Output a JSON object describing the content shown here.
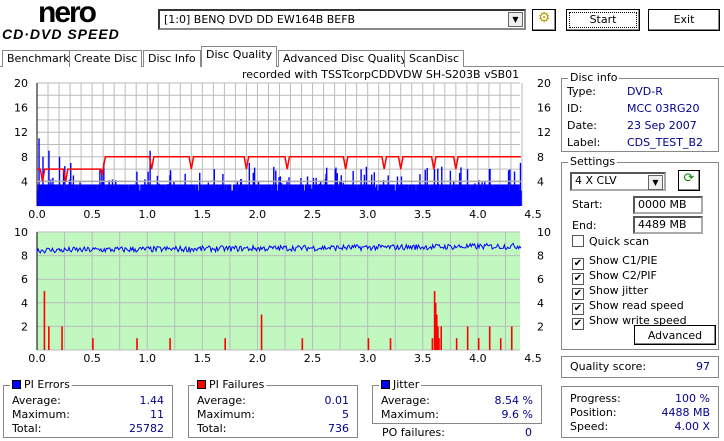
{
  "app": {
    "logo_top": "nero",
    "logo_bottom": "CD·DVD SPEED"
  },
  "toolbar": {
    "drive": "[1:0]  BENQ DVD DD EW164B BEFB",
    "start": "Start",
    "exit": "Exit"
  },
  "tabs": [
    "Benchmark",
    "Create Disc",
    "Disc Info",
    "Disc Quality",
    "Advanced Disc Quality",
    "ScanDisc"
  ],
  "active_tab": "Disc Quality",
  "recorded_with": "recorded with TSSTcorpCDDVDW SH-S203B  vSB01",
  "disc_info": {
    "title": "Disc info",
    "type_label": "Type:",
    "type": "DVD-R",
    "id_label": "ID:",
    "id": "MCC 03RG20",
    "date_label": "Date:",
    "date": "23 Sep 2007",
    "label_label": "Label:",
    "label": "CDS_TEST_B2"
  },
  "settings": {
    "title": "Settings",
    "speed": "4 X CLV",
    "start_label": "Start:",
    "start": "0000 MB",
    "end_label": "End:",
    "end": "4489 MB",
    "checks": [
      {
        "label": "Quick scan",
        "checked": false
      },
      {
        "label": "Show C1/PIE",
        "checked": true
      },
      {
        "label": "Show C2/PIF",
        "checked": true
      },
      {
        "label": "Show jitter",
        "checked": true
      },
      {
        "label": "Show read speed",
        "checked": true
      },
      {
        "label": "Show write speed",
        "checked": true
      }
    ],
    "advanced": "Advanced"
  },
  "quality": {
    "label": "Quality score:",
    "value": "97"
  },
  "progress": {
    "progress_label": "Progress:",
    "progress": "100 %",
    "position_label": "Position:",
    "position": "4488 MB",
    "speed_label": "Speed:",
    "speed": "4.00 X"
  },
  "pi_errors": {
    "title": "PI Errors",
    "avg_label": "Average:",
    "avg": "1.44",
    "max_label": "Maximum:",
    "max": "11",
    "total_label": "Total:",
    "total": "25782"
  },
  "pi_failures": {
    "title": "PI Failures",
    "avg_label": "Average:",
    "avg": "0.01",
    "max_label": "Maximum:",
    "max": "5",
    "total_label": "Total:",
    "total": "736"
  },
  "jitter": {
    "title": "Jitter",
    "avg_label": "Average:",
    "avg": "8.54 %",
    "max_label": "Maximum:",
    "max": "9.6 %"
  },
  "po_failures": {
    "label": "PO failures:",
    "value": "0"
  },
  "colors": {
    "pie": "#0000ff",
    "pif": "#ff0000",
    "speed": "#ff0000",
    "jitter_bg": "#c0f8c0"
  },
  "chart_data": [
    {
      "type": "bar",
      "name": "PI errors (top)",
      "xlim": [
        0,
        4.5
      ],
      "ylim": [
        0,
        20
      ],
      "x_ticks": [
        "0.0",
        "0.5",
        "1.0",
        "1.5",
        "2.0",
        "2.5",
        "3.0",
        "3.5",
        "4.0",
        "4.5"
      ],
      "y_ticks": [
        "4",
        "8",
        "12",
        "16",
        "20"
      ],
      "data_end": 4.39,
      "pie_baseline": 3.5,
      "pie_spikes": [
        [
          0.01,
          11
        ],
        [
          0.05,
          8
        ],
        [
          0.1,
          9
        ],
        [
          0.2,
          8
        ],
        [
          0.3,
          7
        ],
        [
          0.6,
          7
        ],
        [
          1.02,
          9
        ],
        [
          1.6,
          6
        ],
        [
          1.92,
          7
        ],
        [
          2.7,
          6
        ],
        [
          3.6,
          6
        ],
        [
          3.9,
          6
        ],
        [
          4.1,
          6
        ],
        [
          4.38,
          7
        ]
      ],
      "write_speed": [
        [
          0,
          6
        ],
        [
          0.6,
          6
        ],
        [
          0.62,
          8
        ],
        [
          4.39,
          8
        ]
      ],
      "speed_dips": [
        0.05,
        0.26,
        0.6,
        1.04,
        1.4,
        1.9,
        2.27,
        2.8,
        3.15,
        3.3,
        3.6,
        3.8
      ],
      "read_speed_level": 4
    },
    {
      "type": "bar",
      "name": "PI failures / jitter (bottom)",
      "xlim": [
        0,
        4.5
      ],
      "ylim": [
        0,
        10
      ],
      "x_ticks": [
        "0.0",
        "0.5",
        "1.0",
        "1.5",
        "2.0",
        "2.5",
        "3.0",
        "3.5",
        "4.0",
        "4.5"
      ],
      "y_ticks": [
        "2",
        "4",
        "6",
        "8",
        "10"
      ],
      "jitter_mean": 8.6,
      "pif_spikes": [
        [
          0.06,
          5
        ],
        [
          0.1,
          2
        ],
        [
          0.22,
          2
        ],
        [
          0.5,
          1
        ],
        [
          0.9,
          1
        ],
        [
          1.2,
          1
        ],
        [
          1.7,
          1
        ],
        [
          2.03,
          3
        ],
        [
          2.4,
          1
        ],
        [
          3.0,
          1
        ],
        [
          3.2,
          1
        ],
        [
          3.58,
          1
        ],
        [
          3.6,
          5
        ],
        [
          3.61,
          4
        ],
        [
          3.62,
          3
        ],
        [
          3.63,
          2
        ],
        [
          3.64,
          1
        ],
        [
          3.66,
          2
        ],
        [
          3.8,
          1
        ],
        [
          3.9,
          2
        ],
        [
          4.0,
          1
        ],
        [
          4.1,
          2
        ],
        [
          4.2,
          1
        ],
        [
          4.3,
          2
        ]
      ]
    }
  ]
}
